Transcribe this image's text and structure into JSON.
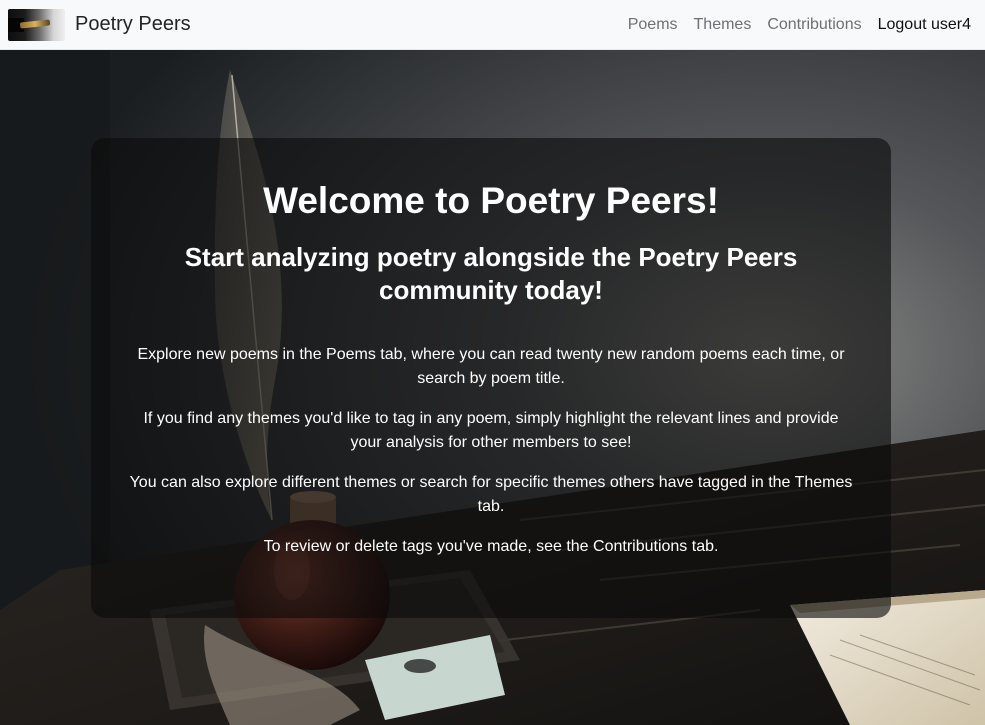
{
  "navbar": {
    "brand_name": "Poetry Peers",
    "logo_icon": "fountain-pen-logo",
    "links": [
      {
        "label": "Poems"
      },
      {
        "label": "Themes"
      },
      {
        "label": "Contributions"
      },
      {
        "label": "Logout user4"
      }
    ]
  },
  "hero": {
    "title": "Welcome to Poetry Peers!",
    "subtitle": "Start analyzing poetry alongside the Poetry Peers community today!",
    "paragraphs": [
      "Explore new poems in the Poems tab, where you can read twenty new random poems each time, or search by poem title.",
      "If you find any themes you'd like to tag in any poem, simply highlight the relevant lines and provide your analysis for other members to see!",
      "You can also explore different themes or search for specific themes others have tagged in the Themes tab.",
      "To review or delete tags you've made, see the Contributions tab."
    ]
  },
  "colors": {
    "navbar_bg": "#f8f9fa",
    "nav_link": "#6c7176",
    "nav_link_active": "#111111",
    "panel_bg": "rgba(12,12,12,0.62)",
    "panel_text": "#ffffff"
  }
}
